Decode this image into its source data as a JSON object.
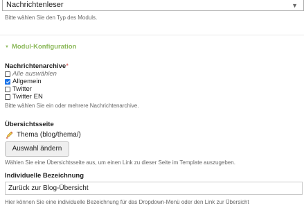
{
  "module_type": {
    "selected": "Nachrichtenleser",
    "help": "Bitte wählen Sie den Typ des Moduls."
  },
  "section": {
    "legend": "Modul-Konfiguration"
  },
  "archives": {
    "label": "Nachrichtenarchive",
    "required_mark": "*",
    "options": [
      {
        "label": "Alle auswählen",
        "checked": false
      },
      {
        "label": "Allgemein",
        "checked": true
      },
      {
        "label": "Twitter",
        "checked": false
      },
      {
        "label": "Twitter EN",
        "checked": false
      }
    ],
    "help": "Bitte wählen Sie ein oder mehrere Nachrichtenarchive."
  },
  "overview_page": {
    "label": "Übersichtsseite",
    "page_title": "Thema (blog/thema/)",
    "change_button": "Auswahl ändern",
    "help": "Wählen Sie eine Übersichtsseite aus, um einen Link zu dieser Seite im Template auszugeben."
  },
  "custom_label": {
    "label": "Individuelle Bezeichnung",
    "value": "Zurück zur Blog-Übersicht",
    "help": "Hier können Sie eine individuelle Bezeichnung für das Dropdown-Menü oder den Link zur Übersicht"
  },
  "colors": {
    "legend": "#8ab858",
    "checkbox_checked": "#1a73e8",
    "required": "#cc3333"
  }
}
